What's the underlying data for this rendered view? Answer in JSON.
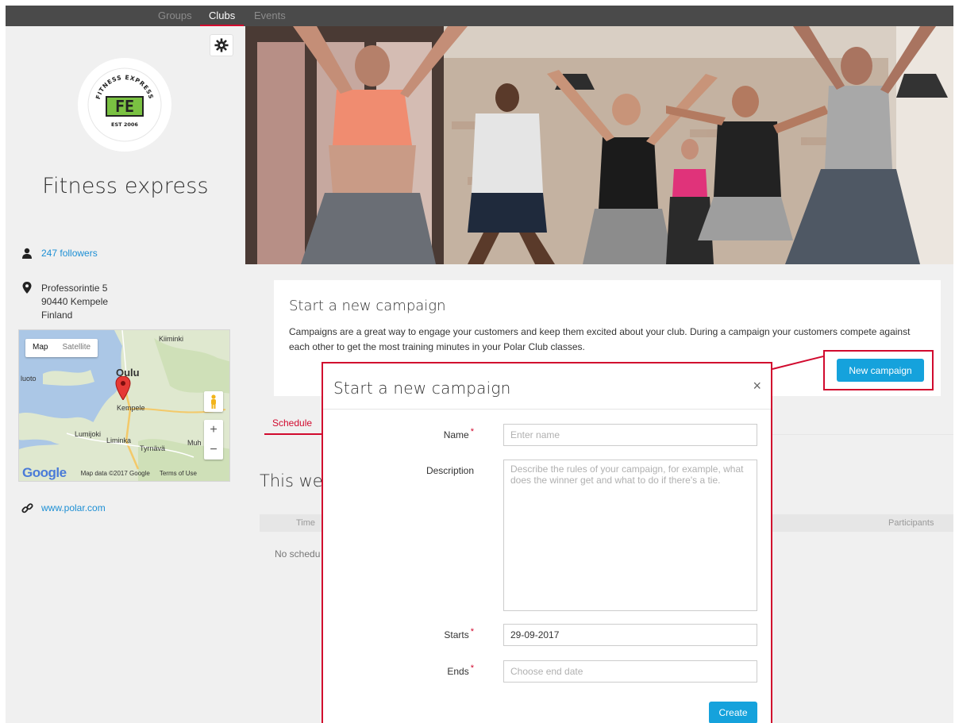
{
  "nav": {
    "items": [
      "Groups",
      "Clubs",
      "Events"
    ]
  },
  "club": {
    "name": "Fitness express",
    "logo_text": "FE",
    "logo_arc_text": "FITNESS EXPRESS",
    "logo_est": "EST 2006",
    "followers": "247 followers",
    "address_line1": "Professorintie 5",
    "address_line2": "90440 Kempele",
    "address_line3": "Finland",
    "website": "www.polar.com"
  },
  "map": {
    "tab_map": "Map",
    "tab_satellite": "Satellite",
    "labels": [
      "Oulu",
      "Kempele",
      "Liminka",
      "Lumijoki",
      "Tyrnävä",
      "Kiiminki",
      "Muh",
      "luoto"
    ],
    "google": "Google",
    "data": "Map data ©2017 Google",
    "terms": "Terms of Use",
    "zoom_in": "+",
    "zoom_out": "−"
  },
  "campaign_card": {
    "title": "Start a new campaign",
    "text": "Campaigns are a great way to engage your customers and keep them excited about your club. During a campaign your customers compete against each other to get the most training minutes in your Polar Club classes.",
    "button": "New campaign"
  },
  "schedule": {
    "tab": "Schedule",
    "week_title": "This wee",
    "col_time": "Time",
    "col_participants": "Participants",
    "empty": "No schedu"
  },
  "modal": {
    "title": "Start a new campaign",
    "close": "×",
    "name_label": "Name",
    "name_placeholder": "Enter name",
    "description_label": "Description",
    "description_placeholder": "Describe the rules of your campaign, for example, what does the winner get and what to do if there's a tie.",
    "starts_label": "Starts",
    "starts_value": "29-09-2017",
    "ends_label": "Ends",
    "ends_placeholder": "Choose end date",
    "required_mark": "*",
    "create": "Create"
  },
  "colors": {
    "accent": "#d10a2e",
    "primary_button": "#15a2dc",
    "link": "#1d8fd4",
    "nav_bg": "#4a4a4a"
  }
}
